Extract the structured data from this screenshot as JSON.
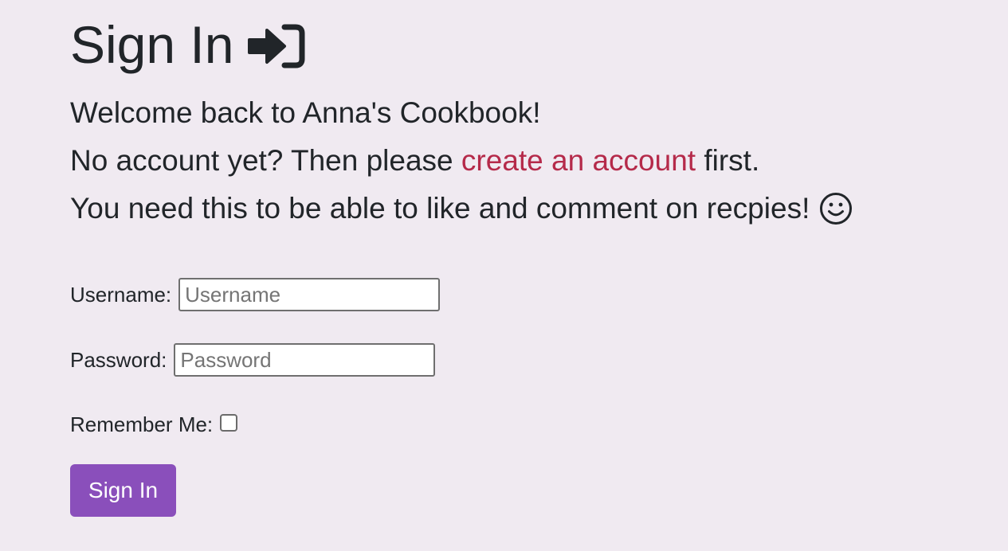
{
  "header": {
    "title": "Sign In",
    "title_icon": "sign-in-arrow-icon"
  },
  "intro": {
    "welcome": "Welcome back to Anna's Cookbook!",
    "no_account_prefix": "No account yet? Then please ",
    "create_account_link": "create an account",
    "no_account_suffix": " first.",
    "need_this": "You need this to be able to like and comment on recpies!",
    "smiley_icon": "smiley-face-icon"
  },
  "form": {
    "username_label": "Username:",
    "username_placeholder": "Username",
    "username_value": "",
    "password_label": "Password:",
    "password_placeholder": "Password",
    "password_value": "",
    "remember_label": "Remember Me:",
    "remember_checked": false,
    "submit_label": "Sign In"
  },
  "colors": {
    "background": "#f0eaf1",
    "link": "#b52a4a",
    "button": "#8a4fbb",
    "text": "#212529"
  }
}
